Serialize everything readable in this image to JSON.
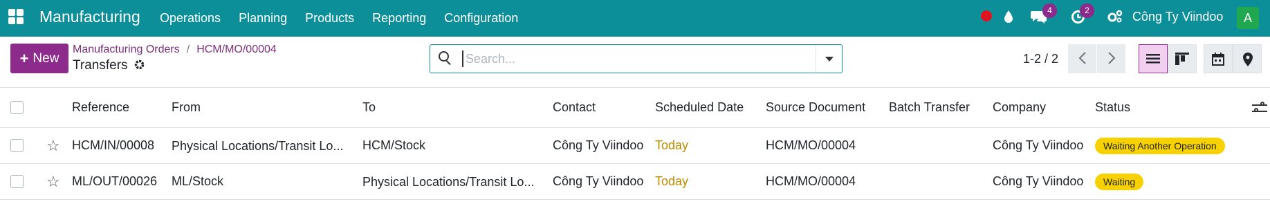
{
  "app": {
    "title": "Manufacturing",
    "menu": [
      "Operations",
      "Planning",
      "Products",
      "Reporting",
      "Configuration"
    ],
    "systray": {
      "messages_count": "4",
      "activities_count": "2",
      "company": "Công Ty Viindoo",
      "avatar_letter": "A"
    }
  },
  "control_panel": {
    "new_label": "New",
    "breadcrumb": {
      "items": [
        "Manufacturing Orders",
        "HCM/MO/00004"
      ],
      "separator": "/",
      "current": "Transfers"
    },
    "search": {
      "placeholder": "Search...",
      "value": ""
    },
    "pager": "1-2 / 2"
  },
  "table": {
    "columns": [
      "Reference",
      "From",
      "To",
      "Contact",
      "Scheduled Date",
      "Source Document",
      "Batch Transfer",
      "Company",
      "Status"
    ],
    "rows": [
      {
        "reference": "HCM/IN/00008",
        "from": "Physical Locations/Transit Lo...",
        "to": "HCM/Stock",
        "contact": "Công Ty Viindoo",
        "scheduled_date": "Today",
        "source_document": "HCM/MO/00004",
        "batch_transfer": "",
        "company": "Công Ty Viindoo",
        "status": "Waiting Another Operation"
      },
      {
        "reference": "ML/OUT/00026",
        "from": "ML/Stock",
        "to": "Physical Locations/Transit Lo...",
        "contact": "Công Ty Viindoo",
        "scheduled_date": "Today",
        "source_document": "HCM/MO/00004",
        "batch_transfer": "",
        "company": "Công Ty Viindoo",
        "status": "Waiting"
      }
    ]
  },
  "colors": {
    "topbar": "#0c8f98",
    "primary": "#8d2b8d",
    "status_badge": "#f8d100",
    "today_text": "#c08a00"
  }
}
